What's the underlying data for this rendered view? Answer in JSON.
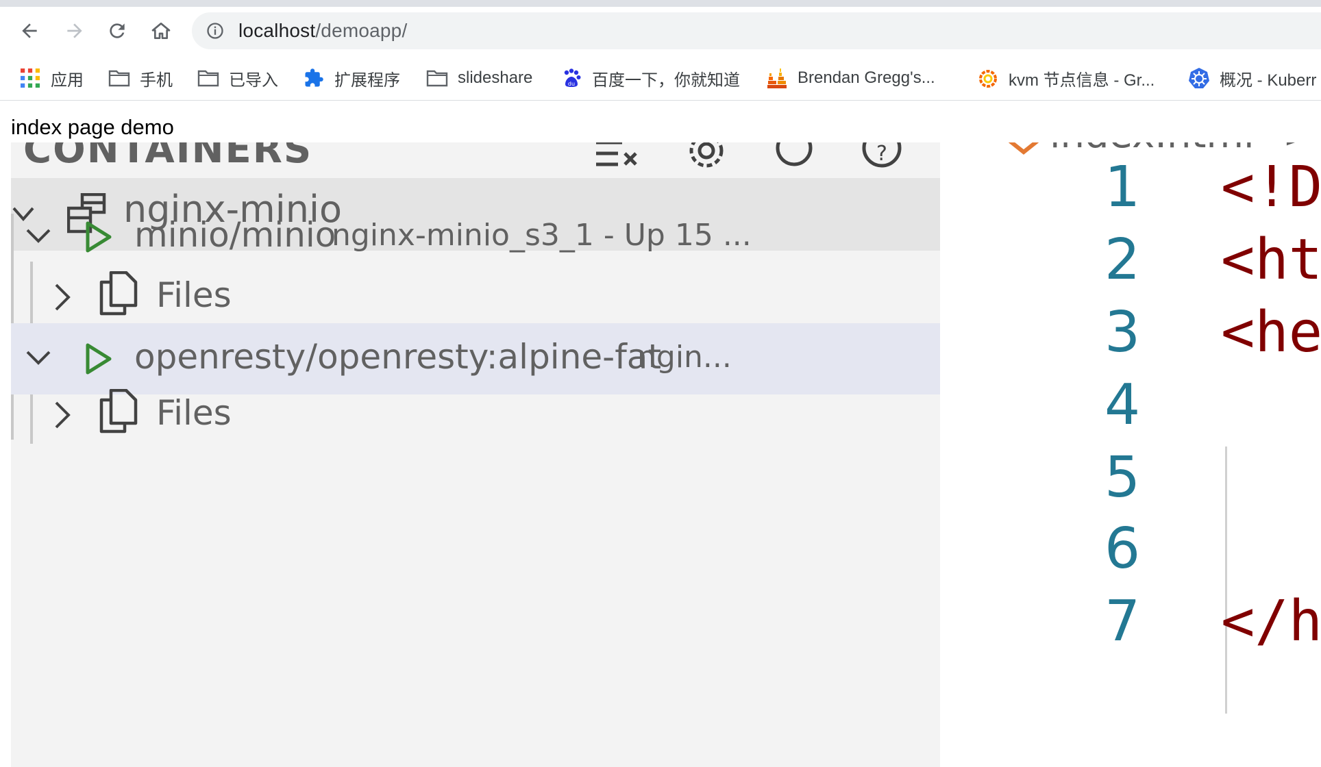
{
  "browser": {
    "url_host": "localhost",
    "url_path": "/demoapp/",
    "bookmarks": [
      {
        "label": "应用",
        "icon": "apps-grid-icon"
      },
      {
        "label": "手机",
        "icon": "folder-icon"
      },
      {
        "label": "已导入",
        "icon": "folder-icon"
      },
      {
        "label": "扩展程序",
        "icon": "puzzle-icon"
      },
      {
        "label": "slideshare",
        "icon": "folder-icon"
      },
      {
        "label": "百度一下，你就知道",
        "icon": "baidu-paw-icon"
      },
      {
        "label": "Brendan Gregg's...",
        "icon": "flame-graph-icon"
      },
      {
        "label": "kvm 节点信息 - Gr...",
        "icon": "grafana-icon"
      },
      {
        "label": "概况 - Kuberr",
        "icon": "kubernetes-icon"
      }
    ]
  },
  "page": {
    "heading": "index page demo"
  },
  "explorer": {
    "section_title": "CONTAINERS",
    "group": {
      "label": "nginx-minio"
    },
    "containers": [
      {
        "image": "minio/minio",
        "detail": "nginx-minio_s3_1 - Up 15 ...",
        "child": "Files"
      },
      {
        "image": "openresty/openresty:alpine-fat",
        "detail": "ngin...",
        "child": "Files"
      }
    ]
  },
  "editor": {
    "breadcrumb": "index.html",
    "line_numbers": [
      "1",
      "2",
      "3",
      "4",
      "5",
      "6",
      "7"
    ],
    "code_lines": [
      "<!D",
      "<ht",
      "<he",
      "",
      "",
      "",
      "</h"
    ]
  },
  "colors": {
    "accent_green": "#388a34",
    "line_number": "#237893",
    "tag": "#800000",
    "selection": "#e4e6f1"
  }
}
